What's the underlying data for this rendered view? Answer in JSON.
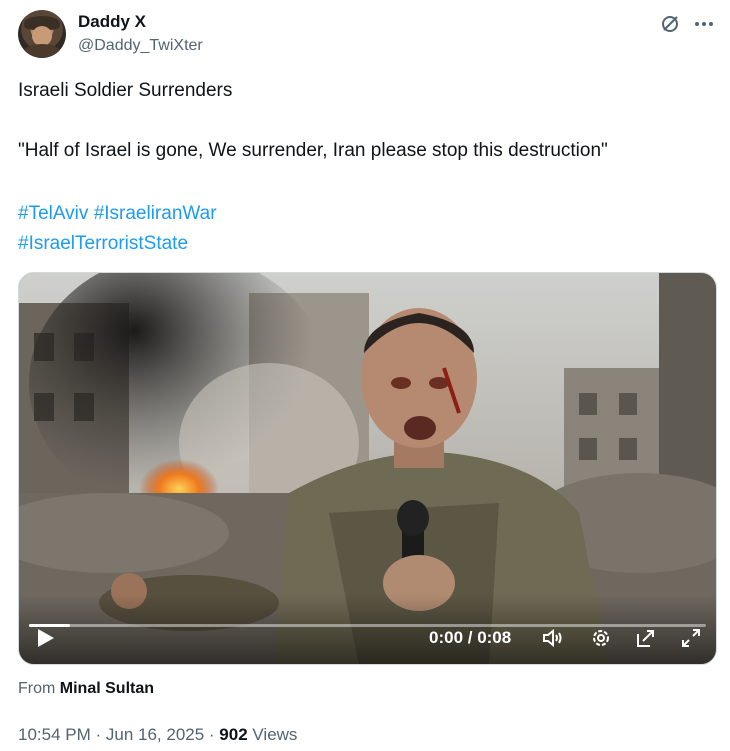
{
  "author": {
    "name": "Daddy X",
    "handle": "@Daddy_TwiXter"
  },
  "tweet": {
    "line1": "Israeli Soldier Surrenders",
    "line2": "\"Half of Israel is gone, We surrender, Iran please stop this destruction\"",
    "hashtags": [
      "#TelAviv",
      "#IsraeliranWar",
      "#IsraelTerroristState"
    ]
  },
  "video": {
    "time": "0:00 / 0:08",
    "progress": 0.06,
    "icons": [
      "play-icon",
      "volume-icon",
      "settings-icon",
      "pip-icon",
      "fullscreen-icon"
    ]
  },
  "from": {
    "prefix": "From",
    "source": "Minal Sultan"
  },
  "meta": {
    "timestamp": "10:54 PM · Jun 16, 2025 · ",
    "views_count": "902",
    "views_label": " Views"
  },
  "header_icons": [
    "grok-icon",
    "more-icon"
  ],
  "colors": {
    "link": "#1d9bf0",
    "text": "#0f1419",
    "secondary": "#536471"
  }
}
